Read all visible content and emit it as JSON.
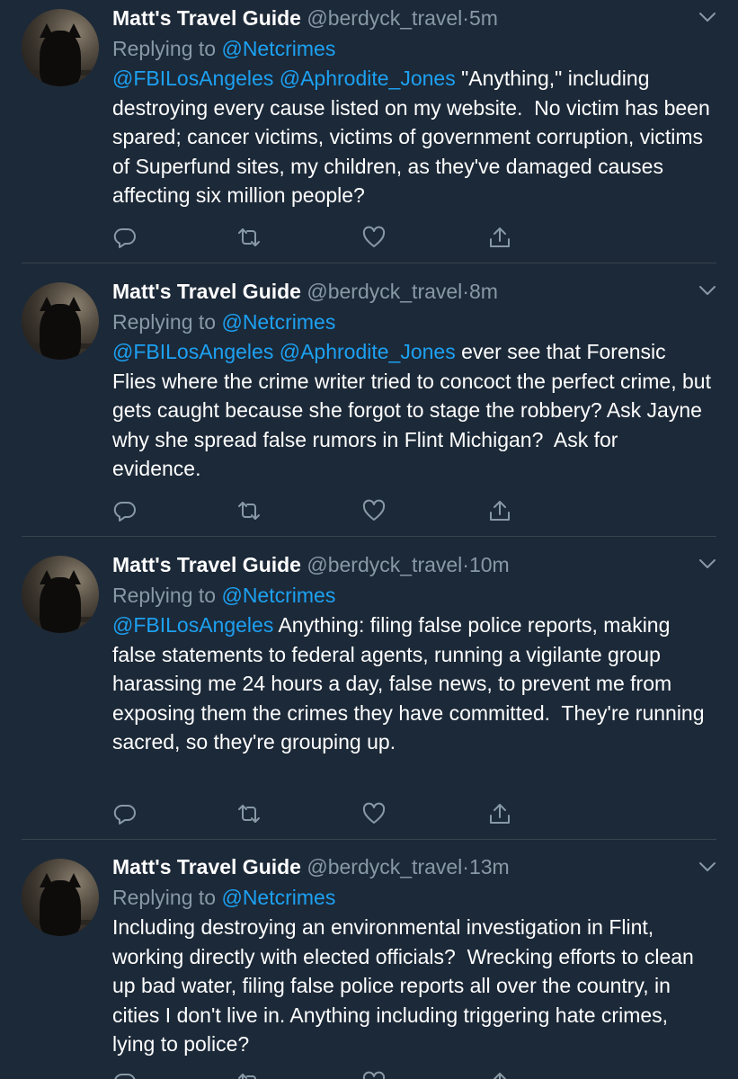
{
  "tweets": [
    {
      "name": "Matt's Travel Guide",
      "handle": "@berdyck_travel",
      "dot": "·",
      "time": "5m",
      "replying_prefix": "Replying to ",
      "replying_to": "@Netcrimes",
      "mentions": "@FBILosAngeles @Aphrodite_Jones",
      "text": " \"Anything,\" including destroying every cause listed on my website.  No victim has been spared; cancer victims, victims of government corruption, victims of Superfund sites, my children, as they've damaged causes affecting six million people?"
    },
    {
      "name": "Matt's Travel Guide",
      "handle": "@berdyck_travel",
      "dot": "·",
      "time": "8m",
      "replying_prefix": "Replying to ",
      "replying_to": "@Netcrimes",
      "mentions": "@FBILosAngeles @Aphrodite_Jones",
      "text": " ever see that Forensic Flies where the crime writer tried to concoct the perfect crime, but gets caught because she forgot to stage the robbery? Ask Jayne why she spread false rumors in Flint Michigan?  Ask for evidence."
    },
    {
      "name": "Matt's Travel Guide",
      "handle": "@berdyck_travel",
      "dot": "·",
      "time": "10m",
      "replying_prefix": "Replying to ",
      "replying_to": "@Netcrimes",
      "mentions": "@FBILosAngeles",
      "text": " Anything: filing false police reports, making false statements to federal agents, running a vigilante group harassing me 24 hours a day, false news, to prevent me from exposing them the crimes they have committed.  They're running sacred, so they're grouping up."
    },
    {
      "name": "Matt's Travel Guide",
      "handle": "@berdyck_travel",
      "dot": "·",
      "time": "13m",
      "replying_prefix": "Replying to ",
      "replying_to": "@Netcrimes",
      "mentions": "",
      "text": "Including destroying an environmental investigation in Flint, working directly with elected officials?  Wrecking efforts to clean up bad water, filing false police reports all over the country, in cities I don't live in. Anything including triggering hate crimes, lying to police?"
    }
  ],
  "icons": {
    "reply": "reply-icon",
    "retweet": "retweet-icon",
    "like": "like-icon",
    "share": "share-icon",
    "more": "chevron-down-icon",
    "avatar": "cat-avatar"
  },
  "colors": {
    "background": "#1c2938",
    "accent": "#1da1f2",
    "secondary_text": "#8899a6",
    "divider": "#38444d"
  }
}
